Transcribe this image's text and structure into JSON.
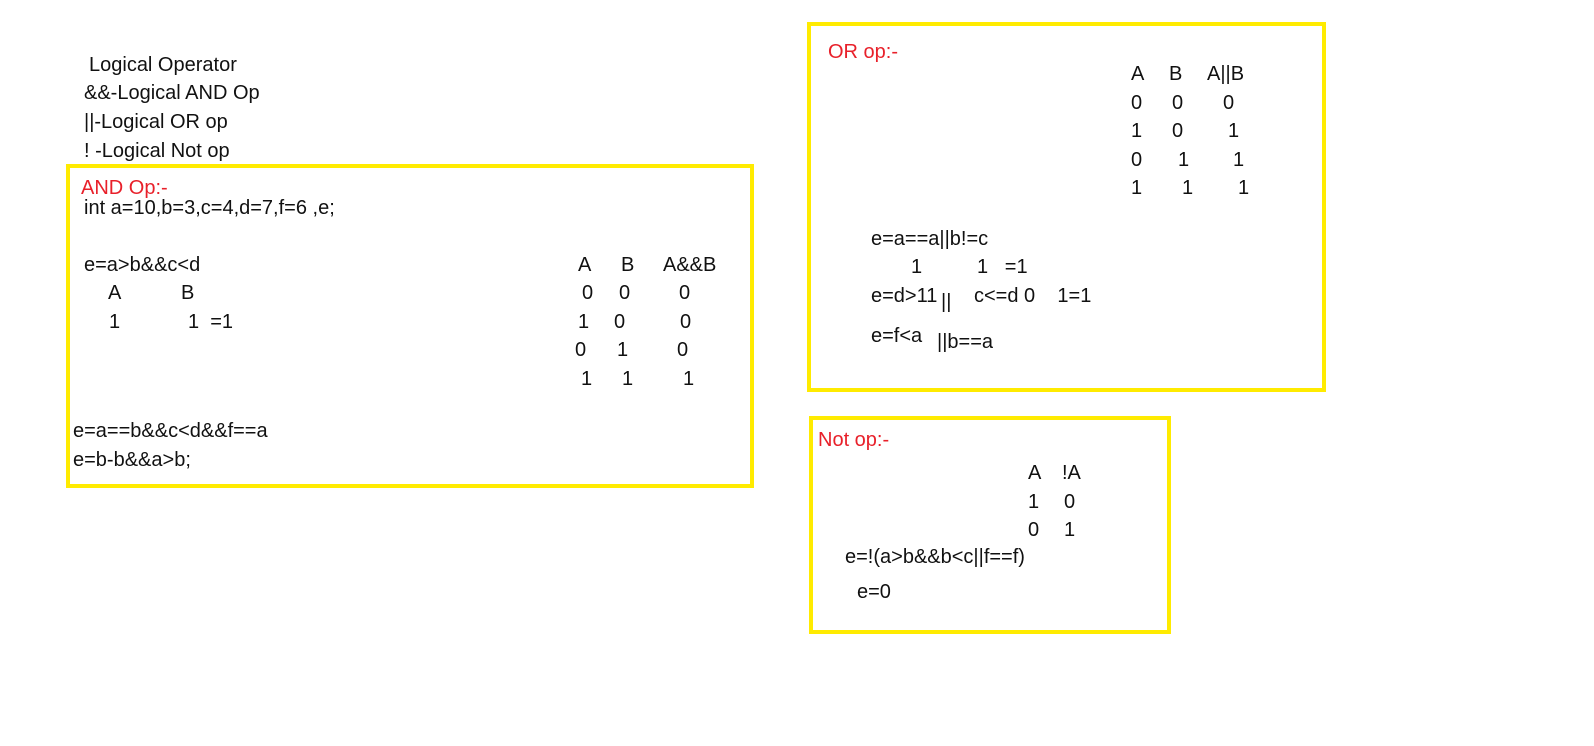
{
  "colors": {
    "highlight_box": "#ffeb00",
    "heading_red": "#e8202a",
    "text": "#111111"
  },
  "intro": {
    "title": "Logical Operator",
    "and_line": "&&-Logical AND Op",
    "or_line": "||-Logical OR op",
    "not_line": "! -Logical Not op"
  },
  "and_box": {
    "heading": "AND Op:-",
    "decl": "int a=10,b=3,c=4,d=7,f=6 ,e;",
    "expr1": "e=a>b&&c<d",
    "expr1_a": "A",
    "expr1_b": "B",
    "eval_1a": "1",
    "eval_1b": "1  =1",
    "table": {
      "headers": [
        "A",
        "B",
        "A&&B"
      ],
      "rows": [
        [
          "0",
          "0",
          "0"
        ],
        [
          "1",
          "0",
          "0"
        ],
        [
          "0",
          "1",
          "0"
        ],
        [
          "1",
          "1",
          "1"
        ]
      ]
    },
    "expr2": "e=a==b&&c<d&&f==a",
    "expr3": "e=b-b&&a>b;"
  },
  "or_box": {
    "heading": "OR op:-",
    "table": {
      "headers": [
        "A",
        "B",
        "A||B"
      ],
      "rows": [
        [
          "0",
          "0",
          "0"
        ],
        [
          "1",
          "0",
          "1"
        ],
        [
          "0",
          "1",
          "1"
        ],
        [
          "1",
          "1",
          "1"
        ]
      ]
    },
    "expr1": "e=a==a||b!=c",
    "eval1_a": "1",
    "eval1_b": "1   =1",
    "expr2_left": "e=d>11",
    "expr2_bar": "||",
    "expr2_right": "c<=d 0    1=1",
    "expr3_left": "e=f<a",
    "expr3_right": "||b==a"
  },
  "not_box": {
    "heading": "Not op:-",
    "table": {
      "headers": [
        "A",
        "!A"
      ],
      "rows": [
        [
          "1",
          "0"
        ],
        [
          "0",
          "1"
        ]
      ]
    },
    "expr": "e=!(a>b&&b<c||f==f)",
    "result": "e=0"
  }
}
